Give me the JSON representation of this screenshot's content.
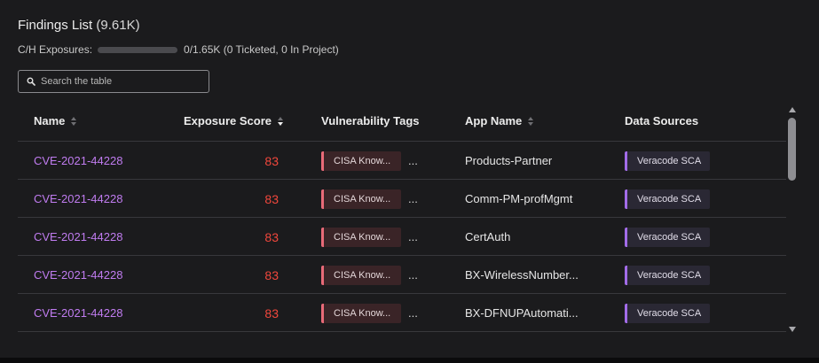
{
  "header": {
    "title": "Findings List",
    "count": "(9.61K)"
  },
  "exposures": {
    "label": "C/H Exposures:",
    "progress_fraction": 0,
    "summary": "0/1.65K (0 Ticketed, 0 In Project)"
  },
  "search": {
    "placeholder": "Search the table",
    "value": ""
  },
  "table": {
    "columns": {
      "name": "Name",
      "exposure_score": "Exposure Score",
      "vulnerability_tags": "Vulnerability Tags",
      "app_name": "App Name",
      "data_sources": "Data Sources"
    },
    "rows": [
      {
        "name": "CVE-2021-44228",
        "score": "83",
        "tag": "CISA Know...",
        "more": "...",
        "app": "Products-Partner",
        "source": "Veracode SCA"
      },
      {
        "name": "CVE-2021-44228",
        "score": "83",
        "tag": "CISA Know...",
        "more": "...",
        "app": "Comm-PM-profMgmt",
        "source": "Veracode SCA"
      },
      {
        "name": "CVE-2021-44228",
        "score": "83",
        "tag": "CISA Know...",
        "more": "...",
        "app": "CertAuth",
        "source": "Veracode SCA"
      },
      {
        "name": "CVE-2021-44228",
        "score": "83",
        "tag": "CISA Know...",
        "more": "...",
        "app": "BX-WirelessNumber...",
        "source": "Veracode SCA"
      },
      {
        "name": "CVE-2021-44228",
        "score": "83",
        "tag": "CISA Know...",
        "more": "...",
        "app": "BX-DFNUPAutomati...",
        "source": "Veracode SCA"
      }
    ]
  },
  "colors": {
    "panel_bg": "#1b1b1d",
    "link": "#c07cf0",
    "score": "#f0473c",
    "tag_accent": "#e86a78",
    "source_accent": "#a26ce8"
  },
  "icons": {
    "search": "search-icon",
    "sort": "sort-icon",
    "more": "ellipsis-icon"
  }
}
